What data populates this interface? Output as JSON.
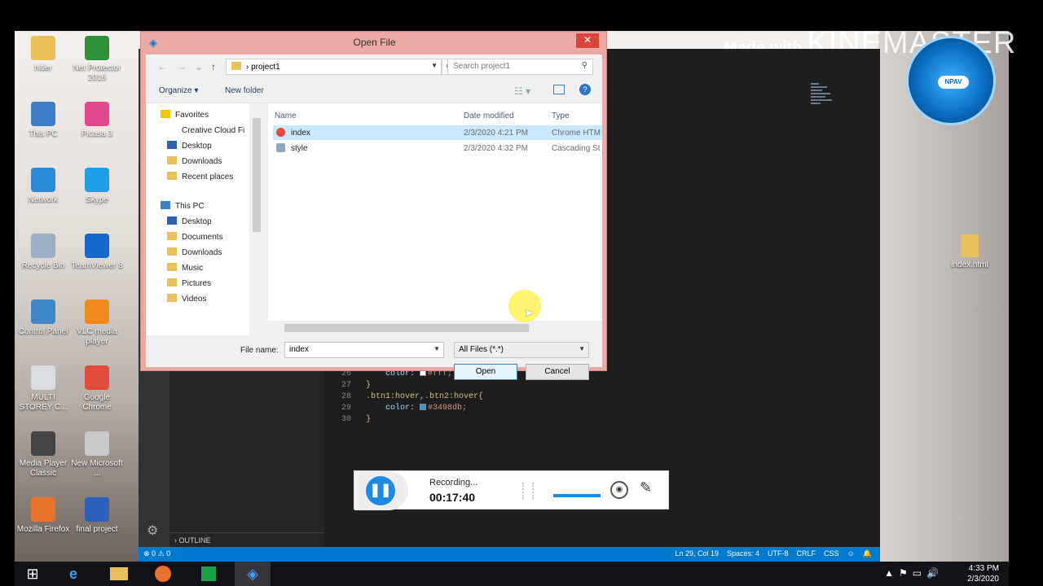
{
  "watermark": {
    "prefix": "Made with",
    "brand": "KINEMASTER"
  },
  "antivirus_badge": "NPAV",
  "desktop_icons": [
    {
      "label": "hitler",
      "color": "#e8c15b"
    },
    {
      "label": "Net Protector 2016",
      "color": "#2f8f3a"
    },
    {
      "label": "This PC",
      "color": "#3b7fc4"
    },
    {
      "label": "Picasa 3",
      "color": "#e04a8c"
    },
    {
      "label": "Network",
      "color": "#2c8bd6"
    },
    {
      "label": "Skype",
      "color": "#1ea0e6"
    },
    {
      "label": "Recycle Bin",
      "color": "#9bb0c4"
    },
    {
      "label": "TeamViewer 8",
      "color": "#1468c8"
    },
    {
      "label": "Control Panel",
      "color": "#3f86c8"
    },
    {
      "label": "VLC media player",
      "color": "#f08a1c"
    },
    {
      "label": "MULTI STOREY C...",
      "color": "#d9dde2"
    },
    {
      "label": "Google Chrome",
      "color": "#e34b3b"
    },
    {
      "label": "Media Player Classic",
      "color": "#444"
    },
    {
      "label": "New Microsoft ...",
      "color": "#c9c9c9"
    },
    {
      "label": "Mozilla Firefox",
      "color": "#e8712b"
    },
    {
      "label": "final project",
      "color": "#2b5fb8"
    }
  ],
  "right_folder": "index.html",
  "vscode": {
    "outline": "OUTLINE",
    "code_lines": [
      {
        "num": "26",
        "text": "    color: ",
        "swatch": "#ffffff",
        "value": "#fff;"
      },
      {
        "num": "27",
        "text": "}"
      },
      {
        "num": "28",
        "text": ".btn1:hover,.btn2:hover{"
      },
      {
        "num": "29",
        "text": "    color: ",
        "swatch": "#3498db",
        "value": "#3498db;"
      },
      {
        "num": "30",
        "text": "}"
      }
    ],
    "status_left": "⊗ 0 ⚠ 0",
    "status_right": [
      "Ln 29, Col 19",
      "Spaces: 4",
      "UTF-8",
      "CRLF",
      "CSS",
      "☺",
      "🔔"
    ]
  },
  "dialog": {
    "title": "Open File",
    "address": "project1",
    "search_placeholder": "Search project1",
    "organize": "Organize ▾",
    "new_folder": "New folder",
    "nav": {
      "favorites": "Favorites",
      "fav_items": [
        "Creative Cloud Fi",
        "Desktop",
        "Downloads",
        "Recent places"
      ],
      "thispc": "This PC",
      "pc_items": [
        "Desktop",
        "Documents",
        "Downloads",
        "Music",
        "Pictures",
        "Videos"
      ]
    },
    "columns": {
      "name": "Name",
      "date": "Date modified",
      "type": "Type"
    },
    "files": [
      {
        "name": "index",
        "date": "2/3/2020 4:21 PM",
        "type": "Chrome HTM",
        "selected": true
      },
      {
        "name": "style",
        "date": "2/3/2020 4:32 PM",
        "type": "Cascading St",
        "selected": false
      }
    ],
    "filename_label": "File name:",
    "filename_value": "index",
    "filetype": "All Files (*.*)",
    "open_btn": "Open",
    "cancel_btn": "Cancel"
  },
  "recorder": {
    "status": "Recording...",
    "time": "00:17:40"
  },
  "clock": {
    "time": "4:33 PM",
    "date": "2/3/2020"
  }
}
